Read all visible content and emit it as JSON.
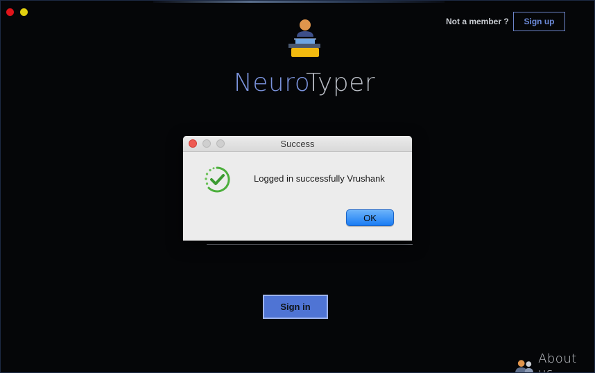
{
  "window": {
    "app_name_part1": "Neuro",
    "app_name_part2": "Typer"
  },
  "header": {
    "not_member_text": "Not a member ?",
    "signup_label": "Sign up"
  },
  "form": {
    "signin_label": "Sign in"
  },
  "footer": {
    "about_label": "About us"
  },
  "dialog": {
    "title": "Success",
    "message": "Logged in successfully Vrushank",
    "ok_label": "OK",
    "icon": "success-check-icon"
  },
  "colors": {
    "accent": "#4f74d4",
    "brand_blue": "#7b93dc",
    "success_green": "#4caf3c",
    "background": "#050608"
  }
}
